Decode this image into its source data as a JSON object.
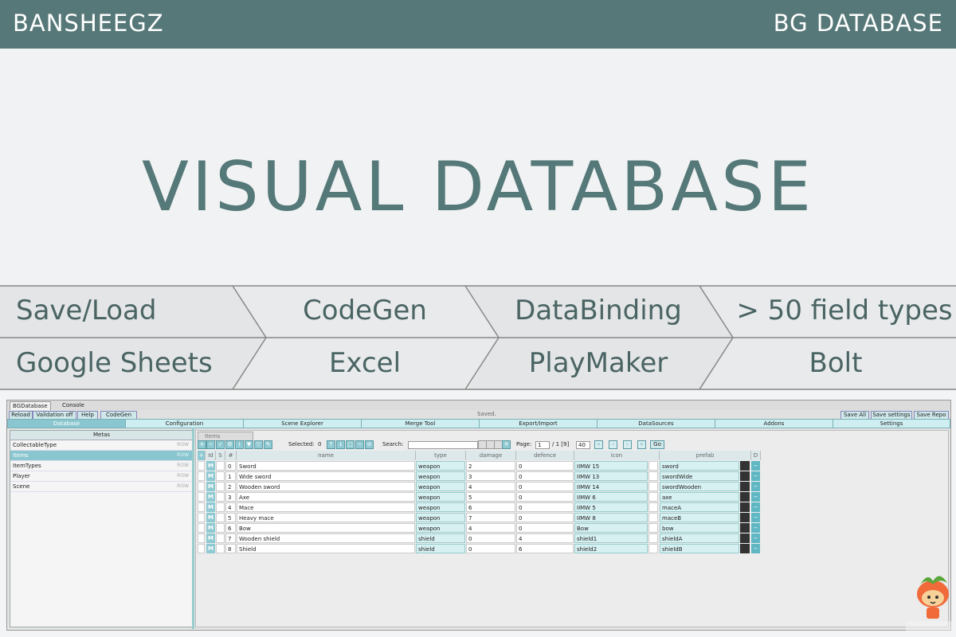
{
  "header": {
    "brand": "BANSHEEGZ",
    "product": "BG DATABASE"
  },
  "headline": "VISUAL DATABASE",
  "features": {
    "row1": [
      "Save/Load",
      "CodeGen",
      "DataBinding",
      "> 50 field types"
    ],
    "row2": [
      "Google Sheets",
      "Excel",
      "PlayMaker",
      "Bolt"
    ]
  },
  "screenshot": {
    "window_tabs": [
      "BGDatabase",
      "Console"
    ],
    "toolbar": [
      "Reload",
      "Validation off",
      "Help",
      "CodeGen"
    ],
    "status": "Saved.",
    "right_buttons": [
      "Save All",
      "Save settings",
      "Save Repo"
    ],
    "nav_tabs": [
      "Database",
      "Configuration",
      "Scene Explorer",
      "Merge Tool",
      "Export/Import",
      "DataSources",
      "Addons",
      "Settings"
    ],
    "metas": {
      "header": "Metas",
      "row_badge": "ROW",
      "items": [
        "CollectableType",
        "Items",
        "ItemTypes",
        "Player",
        "Scene"
      ],
      "selected": "Items"
    },
    "items_tab": "Items",
    "selected_label": "Selected:",
    "selected_count": "0",
    "search_label": "Search:",
    "page_label": "Page:",
    "page_value": "1",
    "page_total": "/ 1 [9]",
    "page_size": "40",
    "go_label": "Go",
    "columns": [
      "Id",
      "S",
      "#",
      "name",
      "type",
      "damage",
      "defence",
      "icon",
      "prefab",
      "D"
    ],
    "rows": [
      {
        "m": "M",
        "n": "0",
        "name": "Sword",
        "type": "weapon",
        "damage": "2",
        "defence": "0",
        "icon": "IIMW 15",
        "prefab": "sword"
      },
      {
        "m": "M",
        "n": "1",
        "name": "Wide sword",
        "type": "weapon",
        "damage": "3",
        "defence": "0",
        "icon": "IIMW 13",
        "prefab": "swordWide"
      },
      {
        "m": "M",
        "n": "2",
        "name": "Wooden sword",
        "type": "weapon",
        "damage": "4",
        "defence": "0",
        "icon": "IIMW 14",
        "prefab": "swordWooden"
      },
      {
        "m": "M",
        "n": "3",
        "name": "Axe",
        "type": "weapon",
        "damage": "5",
        "defence": "0",
        "icon": "IIMW 6",
        "prefab": "axe"
      },
      {
        "m": "M",
        "n": "4",
        "name": "Mace",
        "type": "weapon",
        "damage": "6",
        "defence": "0",
        "icon": "IIMW 5",
        "prefab": "maceA"
      },
      {
        "m": "M",
        "n": "5",
        "name": "Heavy mace",
        "type": "weapon",
        "damage": "7",
        "defence": "0",
        "icon": "IIMW 8",
        "prefab": "maceB"
      },
      {
        "m": "M",
        "n": "6",
        "name": "Bow",
        "type": "weapon",
        "damage": "4",
        "defence": "0",
        "icon": "Bow",
        "prefab": "bow"
      },
      {
        "m": "M",
        "n": "7",
        "name": "Wooden shield",
        "type": "shield",
        "damage": "0",
        "defence": "4",
        "icon": "shield1",
        "prefab": "shieldA"
      },
      {
        "m": "M",
        "n": "8",
        "name": "Shield",
        "type": "shield",
        "damage": "0",
        "defence": "6",
        "icon": "shield2",
        "prefab": "shieldB"
      }
    ]
  },
  "colors": {
    "brand": "#577878",
    "accent": "#8ac6cf"
  }
}
